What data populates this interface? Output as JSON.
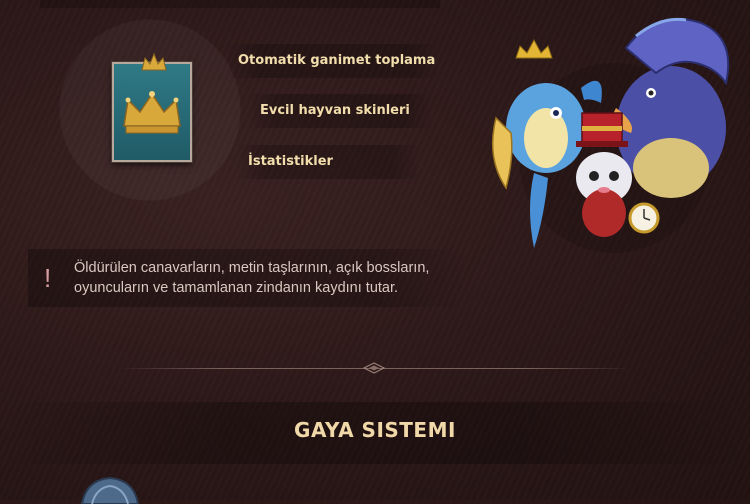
{
  "features": {
    "items": [
      {
        "label": "Otomatik ganimet toplama"
      },
      {
        "label": "Evcil hayvan skinleri"
      },
      {
        "label": "İstatistikler"
      }
    ]
  },
  "badge": {
    "icon": "crown-icon",
    "accent": "#d8a93a",
    "background": "#2a6f7b"
  },
  "pets": {
    "icon": "pet-group-illustration"
  },
  "info": {
    "icon": "exclamation-icon",
    "text": "Öldürülen canavarların, metin taşlarının, açık bossların, oyuncuların ve tamamlanan zindanın kaydını tutar."
  },
  "section": {
    "title": "GAYA SISTEMI"
  },
  "colors": {
    "background": "#2b1717",
    "title": "#f0d8a8",
    "feature_text": "#f2deac",
    "body_text": "#d9c8c0"
  }
}
